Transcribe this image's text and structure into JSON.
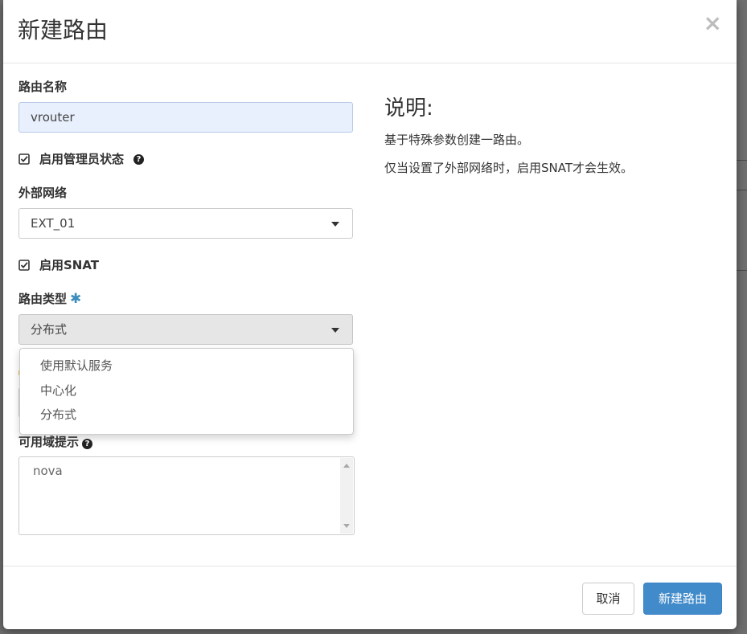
{
  "modal": {
    "title": "新建路由",
    "close_symbol": "×"
  },
  "form": {
    "router_name": {
      "label": "路由名称",
      "value": "vrouter"
    },
    "admin_state": {
      "label": "启用管理员状态",
      "checked": true,
      "help_icon": "question-circle-icon"
    },
    "external_network": {
      "label": "外部网络",
      "selected": "EXT_01"
    },
    "enable_snat": {
      "label": "启用SNAT",
      "checked": true
    },
    "router_type": {
      "label": "路由类型",
      "required_mark": "✱",
      "selected": "分布式",
      "options": [
        "使用默认服务",
        "中心化",
        "分布式"
      ]
    },
    "az_hints": {
      "label": "可用域提示",
      "help_icon": "question-circle-icon",
      "options": [
        "nova"
      ]
    }
  },
  "description": {
    "title": "说明:",
    "lines": [
      "基于特殊参数创建一路由。",
      "仅当设置了外部网络时，启用SNAT才会生效。"
    ]
  },
  "footer": {
    "cancel_label": "取消",
    "submit_label": "新建路由"
  },
  "colors": {
    "primary": "#428bca",
    "required_star": "#3c8dbc",
    "autofill_bg": "#e8f0fd"
  }
}
